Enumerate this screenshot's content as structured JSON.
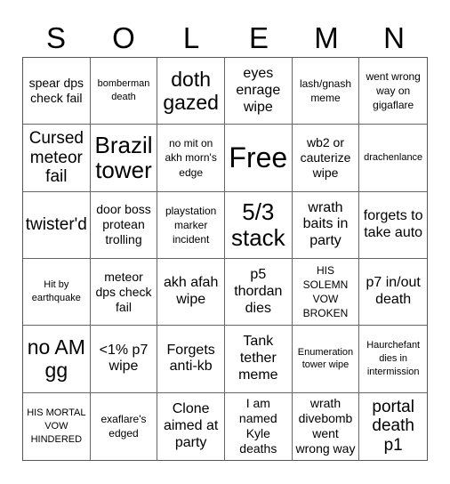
{
  "header": {
    "letters": [
      "S",
      "O",
      "L",
      "E",
      "M",
      "N"
    ]
  },
  "board": {
    "rows": [
      [
        "spear dps check fail",
        "bomberman death",
        "doth gazed",
        "eyes enrage wipe",
        "lash/gnash meme",
        "went wrong way on gigaflare"
      ],
      [
        "Cursed meteor fail",
        "Brazil tower",
        "no mit on akh morn's edge",
        "Free",
        "wb2 or cauterize wipe",
        "drachenlance"
      ],
      [
        "twister'd",
        "door boss protean trolling",
        "playstation marker incident",
        "5/3 stack",
        "wrath baits in party",
        "forgets to take auto"
      ],
      [
        "Hit by earthquake",
        "meteor dps check fail",
        "akh afah wipe",
        "p5 thordan dies",
        "HIS SOLEMN VOW BROKEN",
        "p7 in/out death"
      ],
      [
        "no AM gg",
        "<1% p7 wipe",
        "Forgets anti-kb",
        "Tank tether meme",
        "Enumeration tower wipe",
        "Haurchefant dies in intermission"
      ],
      [
        "HIS MORTAL VOW HINDERED",
        "exaflare's edged",
        "Clone aimed at party",
        "I am named Kyle deaths",
        "wrath divebomb went wrong way",
        "portal death p1"
      ]
    ],
    "free_space": {
      "row": 1,
      "col": 3
    }
  }
}
